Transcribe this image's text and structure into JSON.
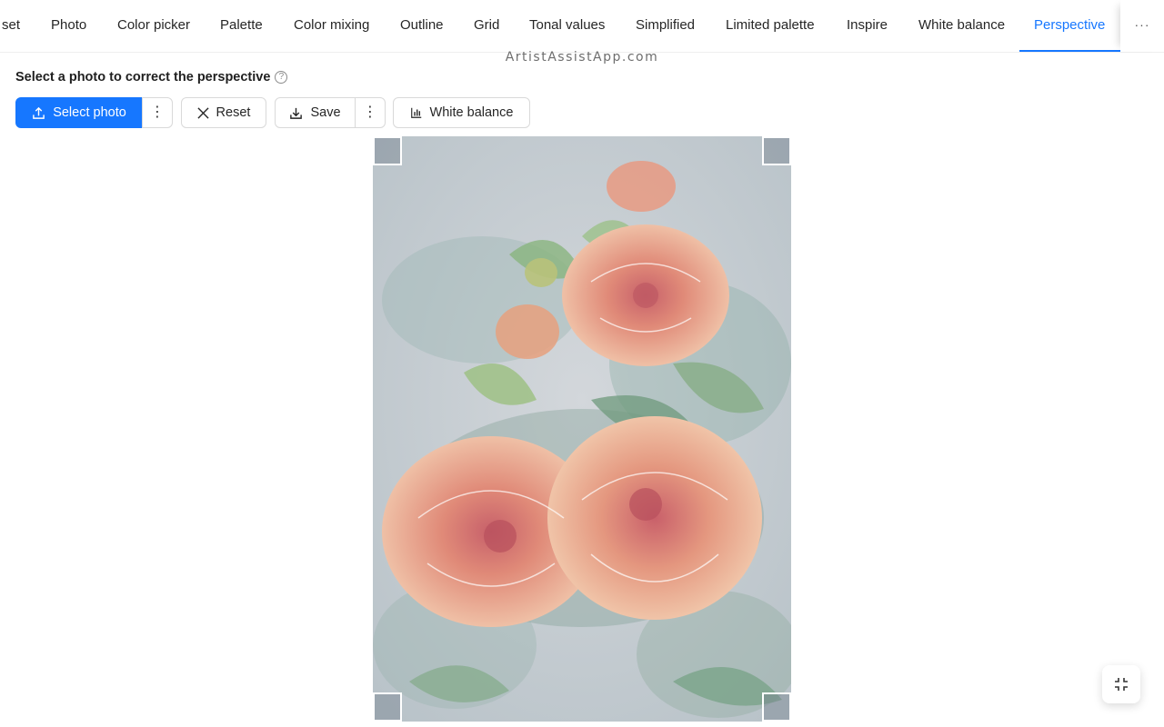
{
  "tabs": [
    {
      "label": "set",
      "active": false
    },
    {
      "label": "Photo",
      "active": false
    },
    {
      "label": "Color picker",
      "active": false
    },
    {
      "label": "Palette",
      "active": false
    },
    {
      "label": "Color mixing",
      "active": false
    },
    {
      "label": "Outline",
      "active": false
    },
    {
      "label": "Grid",
      "active": false
    },
    {
      "label": "Tonal values",
      "active": false
    },
    {
      "label": "Simplified",
      "active": false
    },
    {
      "label": "Limited palette",
      "active": false
    },
    {
      "label": "Inspire",
      "active": false
    },
    {
      "label": "White balance",
      "active": false
    },
    {
      "label": "Perspective",
      "active": true
    }
  ],
  "more_label": "···",
  "brand": "ArtistAssistApp.com",
  "instruction": "Select a photo to correct the perspective",
  "toolbar": {
    "select_photo": "Select photo",
    "reset": "Reset",
    "save": "Save",
    "white_balance": "White balance",
    "menu_dots": "⋮"
  },
  "help_glyph": "?",
  "colors": {
    "accent": "#1677ff"
  },
  "icons": [
    "upload-icon",
    "close-icon",
    "download-icon",
    "bar-chart-icon",
    "help-circle-icon",
    "fullscreen-exit-icon"
  ]
}
